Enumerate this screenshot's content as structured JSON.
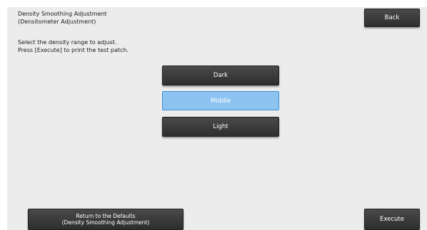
{
  "header": {
    "title_line1": "Density Smoothing Adjustment",
    "title_line2": "(Densitometer Adjustment)"
  },
  "instructions": {
    "line1": "Select the density range to adjust.",
    "line2": "Press [Execute] to print the test patch."
  },
  "buttons": {
    "back": "Back",
    "execute": "Execute",
    "defaults_line1": "Return to the Defaults",
    "defaults_line2": "(Density Smoothing Adjustment)"
  },
  "range_options": [
    {
      "label": "Dark",
      "selected": false
    },
    {
      "label": "Middle",
      "selected": true
    },
    {
      "label": "Light",
      "selected": false
    }
  ],
  "colors": {
    "selected_fill": "#8cc3f0",
    "selected_border": "#3d8fd4",
    "button_dark": "#2e2e2e",
    "panel_bg": "#ececec"
  }
}
